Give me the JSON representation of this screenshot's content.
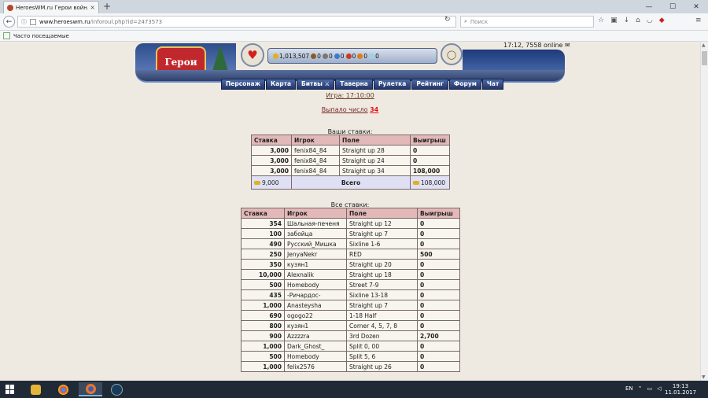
{
  "browser": {
    "tab_title": "HeroesWM.ru Герои войн…",
    "tab_close": "×",
    "new_tab": "+",
    "url_host": "www.heroeswm.ru",
    "url_path": "/inforoul.php?id=2473573",
    "search_placeholder": "Поиск",
    "bookmark": "Часто посещаемые"
  },
  "game": {
    "logo_text": "Герои",
    "online": "17:12, 7558 online",
    "resources": [
      "1,013,507",
      "0",
      "0",
      "0",
      "0",
      "0",
      "0"
    ],
    "menu": [
      "Персонаж",
      "Карта",
      "Битвы",
      "Таверна",
      "Рулетка",
      "Рейтинг",
      "Форум",
      "Чат"
    ],
    "game_label": "Игра: 17:10:00",
    "result_label": "Выпало число",
    "result_number": "34"
  },
  "your_bets": {
    "caption": "Ваши ставки:",
    "headers": [
      "Ставка",
      "Игрок",
      "Поле",
      "Выигрыш"
    ],
    "rows": [
      [
        "3,000",
        "fenix84_84",
        "Straight up 28",
        "0"
      ],
      [
        "3,000",
        "fenix84_84",
        "Straight up 24",
        "0"
      ],
      [
        "3,000",
        "fenix84_84",
        "Straight up 34",
        "108,000"
      ]
    ],
    "total_stake": "9,000",
    "total_label": "Всего",
    "total_win": "108,000"
  },
  "all_bets": {
    "caption": "Все ставки:",
    "headers": [
      "Ставка",
      "Игрок",
      "Поле",
      "Выигрыш"
    ],
    "rows": [
      [
        "354",
        "Шальная-печеня",
        "Straight up 12",
        "0"
      ],
      [
        "100",
        "забойца",
        "Straight up 7",
        "0"
      ],
      [
        "490",
        "Русский_Мишка",
        "Sixline 1-6",
        "0"
      ],
      [
        "250",
        "JenyaNekr",
        "RED",
        "500"
      ],
      [
        "350",
        "кузян1",
        "Straight up 20",
        "0"
      ],
      [
        "10,000",
        "Alexnalik",
        "Straight up 18",
        "0"
      ],
      [
        "500",
        "Homebody",
        "Street 7-9",
        "0"
      ],
      [
        "435",
        "-Ричардос-",
        "Sixline 13-18",
        "0"
      ],
      [
        "1,000",
        "Anasteysha",
        "Straight up 7",
        "0"
      ],
      [
        "690",
        "ogogo22",
        "1-18 Half",
        "0"
      ],
      [
        "800",
        "кузян1",
        "Corner 4, 5, 7, 8",
        "0"
      ],
      [
        "900",
        "Azzzzra",
        "3rd Dozen",
        "2,700"
      ],
      [
        "1,000",
        "Dark_Ghost_",
        "Split 0, 00",
        "0"
      ],
      [
        "500",
        "Homebody",
        "Split 5, 6",
        "0"
      ],
      [
        "1,000",
        "felix2576",
        "Straight up 26",
        "0"
      ]
    ]
  },
  "taskbar": {
    "lang": "EN",
    "time": "19:13",
    "date": "11.01.2017"
  },
  "colors": {
    "header_bg": "#e3b8b8",
    "total_bg": "#dfe0f4",
    "result_number": "#e81010",
    "menu_bg": "#22356a"
  }
}
